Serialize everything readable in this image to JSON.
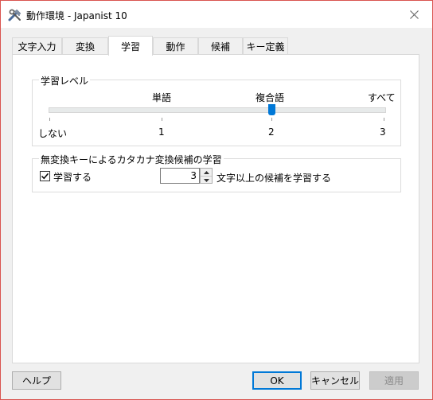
{
  "window": {
    "title": "動作環境 - Japanist 10"
  },
  "tabs": [
    {
      "label": "文字入力",
      "selected": false
    },
    {
      "label": "変換",
      "selected": false
    },
    {
      "label": "学習",
      "selected": true
    },
    {
      "label": "動作",
      "selected": false
    },
    {
      "label": "候補",
      "selected": false
    },
    {
      "label": "キー定義",
      "selected": false
    }
  ],
  "learning_level": {
    "title": "学習レベル",
    "level_names": [
      "単語",
      "複合語",
      "すべて"
    ],
    "bottom_labels": [
      "しない",
      "1",
      "2",
      "3"
    ],
    "slider_value": 2
  },
  "katakana_learning": {
    "title": "無変換キーによるカタカナ変換候補の学習",
    "checkbox_label": "学習する",
    "checkbox_checked": true,
    "spin_value": "3",
    "suffix_text": "文字以上の候補を学習する"
  },
  "buttons": {
    "help": "ヘルプ",
    "ok": "OK",
    "cancel": "キャンセル",
    "apply": "適用"
  },
  "colors": {
    "accent": "#0078d7",
    "window_border": "#d9544f"
  }
}
